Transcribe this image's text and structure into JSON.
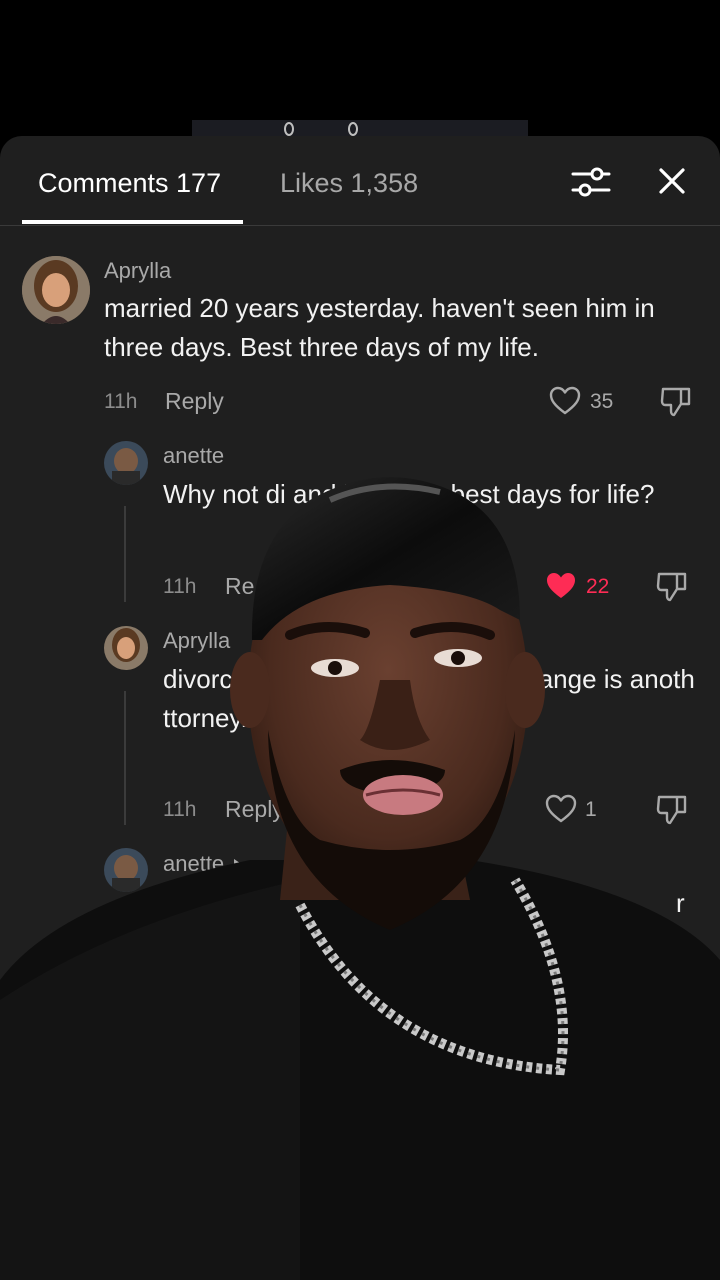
{
  "tabs": {
    "comments_label": "Comments 177",
    "likes_label": "Likes 1,358"
  },
  "icons": {
    "filter": "sliders-icon",
    "close": "close-icon",
    "like": "heart-icon",
    "dislike": "thumbs-down-icon"
  },
  "colors": {
    "sheet_bg": "#1f1f1f",
    "liked": "#fe2c55",
    "secondary_text": "#a9a9a9"
  },
  "comments": [
    {
      "author": "Aprylla",
      "text": "married 20 years yesterday. haven't seen him in three days. Best three days of my life.",
      "time": "11h",
      "reply_label": "Reply",
      "likes": "35",
      "liked": false
    },
    {
      "author": "anette",
      "text": "Why not di and have the best days for life?",
      "time": "11h",
      "reply_label": "Re",
      "likes": "22",
      "liked": true
    },
    {
      "author": "Aprylla",
      "text": "divorc specially when e Every change is anoth ttorney.",
      "time": "11h",
      "reply_label": "Reply",
      "likes": "1",
      "liked": false
    },
    {
      "author": "anette",
      "text": "r"
    }
  ]
}
